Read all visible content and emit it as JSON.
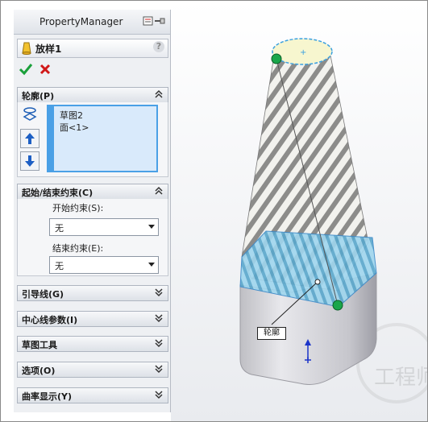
{
  "property_manager": {
    "title": "PropertyManager",
    "feature_name": "放样1",
    "help_glyph": "?",
    "ok_glyph": "✔",
    "cancel_glyph": "✖"
  },
  "sections": {
    "profile": {
      "title": "轮廓(P)",
      "items": [
        "草图2",
        "面<1>"
      ]
    },
    "start_end": {
      "title": "起始/结束约束(C)",
      "start_label": "开始约束(S):",
      "start_value": "无",
      "end_label": "结束约束(E):",
      "end_value": "无"
    },
    "guides": {
      "title": "引导线(G)"
    },
    "centerline": {
      "title": "中心线参数(I)"
    },
    "sketch_tools": {
      "title": "草图工具"
    },
    "options": {
      "title": "选项(O)"
    },
    "curvature": {
      "title": "曲率显示(Y)"
    }
  },
  "viewport": {
    "callout_label": "轮廓",
    "watermark": "工程师"
  },
  "colors": {
    "accent": "#4aa0e6",
    "selection_face": "#7fc6e6",
    "profile_point": "#19a64a"
  }
}
